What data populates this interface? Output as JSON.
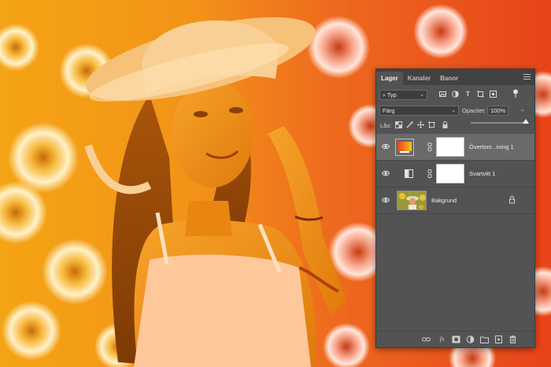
{
  "colors": {
    "panel_bg": "#535353",
    "tab_bar_bg": "#424242",
    "selected_row": "#6a6a6a",
    "accent_orange": "#f28a10",
    "accent_red": "#e8431a"
  },
  "panel": {
    "tabs": [
      {
        "label": "Lager",
        "active": true
      },
      {
        "label": "Kanaler",
        "active": false
      },
      {
        "label": "Banor",
        "active": false
      }
    ],
    "filter": {
      "label": "Typ",
      "icons": [
        "image-filter-icon",
        "adjustment-filter-icon",
        "type-filter-icon",
        "shape-filter-icon",
        "smart-object-filter-icon",
        "filter-toggle-icon"
      ]
    },
    "blend": {
      "mode": "Färg",
      "opacity_label": "Opacitet:",
      "opacity_value": "100%"
    },
    "lock": {
      "label": "Lås:",
      "icons": [
        "lock-transparent-icon",
        "lock-image-icon",
        "lock-position-icon",
        "lock-artboard-icon",
        "lock-all-icon"
      ],
      "fill_slider_level": 1.0
    },
    "layers": [
      {
        "name": "Övertoni...ining 1",
        "kind": "gradient-map",
        "selected": true,
        "visible": true
      },
      {
        "name": "Svartvitt 1",
        "kind": "black-white",
        "selected": false,
        "visible": true
      },
      {
        "name": "Bakgrund",
        "kind": "background",
        "selected": false,
        "visible": true,
        "locked": true
      }
    ],
    "footer_icons": [
      "link-layers-icon",
      "fx-icon",
      "add-mask-icon",
      "adjustment-layer-icon",
      "new-group-icon",
      "new-layer-icon",
      "delete-layer-icon"
    ]
  }
}
